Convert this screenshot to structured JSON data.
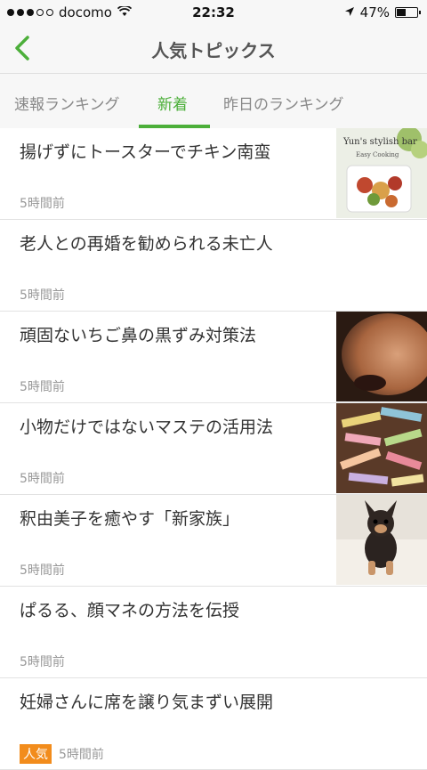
{
  "status_bar": {
    "carrier": "docomo",
    "time": "22:32",
    "battery_percent": "47%",
    "battery_level": 0.47
  },
  "navbar": {
    "title": "人気トピックス",
    "back_icon": "chevron-left-icon"
  },
  "tabs": [
    {
      "label": "速報ランキング",
      "active": false
    },
    {
      "label": "新着",
      "active": true
    },
    {
      "label": "昨日のランキング",
      "active": false
    }
  ],
  "articles": [
    {
      "title": "揚げずにトースターでチキン南蛮",
      "time": "5時間前",
      "thumbnail": "food-dish",
      "thumb_text": "Yun's stylish bar",
      "thumb_subtext": "Easy Cooking"
    },
    {
      "title": "老人との再婚を勧められる未亡人",
      "time": "5時間前"
    },
    {
      "title": "頑固ないちご鼻の黒ずみ対策法",
      "time": "5時間前",
      "thumbnail": "nose"
    },
    {
      "title": "小物だけではないマステの活用法",
      "time": "5時間前",
      "thumbnail": "masking-tape"
    },
    {
      "title": "釈由美子を癒やす「新家族」",
      "time": "5時間前",
      "thumbnail": "puppy"
    },
    {
      "title": "ぱるる、顔マネの方法を伝授",
      "time": "5時間前"
    },
    {
      "title": "妊婦さんに席を譲り気まずい展開",
      "time": "5時間前",
      "badge": "人気"
    }
  ],
  "colors": {
    "accent": "#4caf3a",
    "badge": "#f28c1c"
  }
}
